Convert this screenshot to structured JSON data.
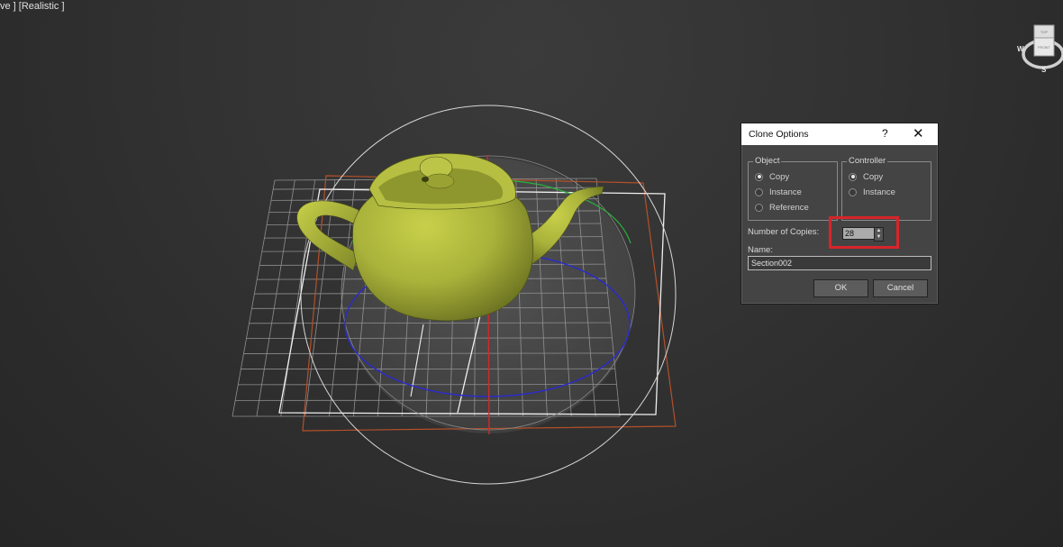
{
  "viewport": {
    "label": "ve ] [Realistic ]"
  },
  "viewcube": {
    "top_face": "TOP",
    "front_face": "FRONT",
    "compass_west": "W",
    "compass_south": "S"
  },
  "dialog": {
    "title": "Clone Options",
    "help_symbol": "?",
    "close_symbol": "✕",
    "object_group": {
      "label": "Object",
      "options": [
        "Copy",
        "Instance",
        "Reference"
      ],
      "selected": "Copy"
    },
    "controller_group": {
      "label": "Controller",
      "options": [
        "Copy",
        "Instance"
      ],
      "selected": "Copy"
    },
    "copies_label": "Number of Copies:",
    "copies_value": "28",
    "name_label": "Name:",
    "name_value": "Section002",
    "ok_label": "OK",
    "cancel_label": "Cancel"
  },
  "colors": {
    "teapot": "#a9b23a",
    "highlight_box": "#d8242a",
    "gizmo_blue": "#2a2ad0",
    "gizmo_red": "#d02a2a",
    "gizmo_green": "#2ab03a"
  }
}
